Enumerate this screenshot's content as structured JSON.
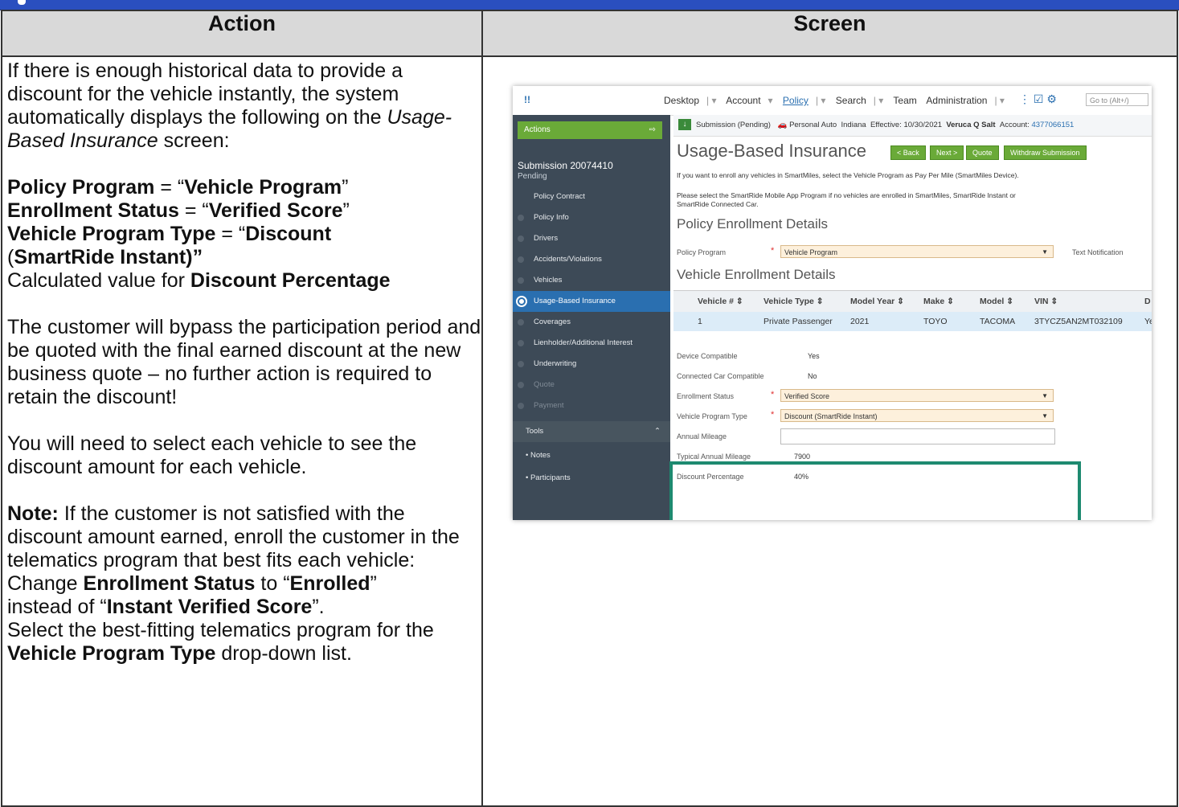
{
  "header": {
    "action": "Action",
    "screen": "Screen"
  },
  "action": {
    "intro": "If there is enough historical data to provide a discount for the vehicle instantly, the system automatically displays the following on the ",
    "intro_screen": "Usage-Based Insurance",
    "intro_end": " screen:",
    "l1_label": "Policy Program",
    "l1_eq": " = “",
    "l1_value": "Vehicle Program",
    "l1_end": "”",
    "l2_label": "Enrollment Status",
    "l2_eq": " = “",
    "l2_value": "Verified Score",
    "l2_end": "”",
    "l3_label": "Vehicle Program Type",
    "l3_eq": " = “",
    "l3_value": "Discount",
    "l3_paren": " (",
    "l3_value2": "SmartRide Instant)”",
    "l4_prefix": "Calculated value for ",
    "l4_label": "Discount Percentage",
    "bypass": "The customer will bypass the participation period and be quoted with the final earned discount at the new business quote – no further action is required to retain the discount!",
    "select_each": "You will need to select each vehicle to see the discount amount for each vehicle.",
    "note_label": "Note:",
    "note_text": " If the customer is not satisfied with the discount amount earned, enroll the customer in the telematics program that best fits each vehicle:",
    "change_a": "Change ",
    "change_b": "Enrollment Status",
    "change_c": " to “",
    "change_d": "Enrolled",
    "change_e": "”",
    "instead_a": "instead of “",
    "instead_b": "Instant Verified Score",
    "instead_c": "”.",
    "select_a": "Select the best-fitting telematics program for the ",
    "select_b": "Vehicle Program Type",
    "select_c": " drop-down list."
  },
  "screenshot": {
    "nav": {
      "desktop": "Desktop",
      "account": "Account",
      "policy": "Policy",
      "search": "Search",
      "team": "Team",
      "administration": "Administration",
      "goto_placeholder": "Go to (Alt+/)"
    },
    "sidebar": {
      "actions": "Actions",
      "submission": "Submission 20074410",
      "status": "Pending",
      "items": [
        "Policy Contract",
        "Policy Info",
        "Drivers",
        "Accidents/Violations",
        "Vehicles",
        "Usage-Based Insurance",
        "Coverages",
        "Lienholder/Additional Interest",
        "Underwriting",
        "Quote",
        "Payment"
      ],
      "tools": "Tools",
      "notes": "• Notes",
      "participants": "• Participants"
    },
    "infobar": {
      "submission": "Submission (Pending)",
      "line": "Personal Auto",
      "state": "Indiana",
      "effective": "Effective: 10/30/2021",
      "insured": "Veruca Q Salt",
      "account_label": "Account:",
      "account_no": "4377066151"
    },
    "title": "Usage-Based Insurance",
    "buttons": {
      "back": "< Back",
      "next": "Next >",
      "quote": "Quote",
      "withdraw": "Withdraw Submission"
    },
    "msg1": "If you want to enroll any vehicles in SmartMiles, select the Vehicle Program as Pay Per Mile (SmartMiles Device).",
    "msg2": "Please select the SmartRide Mobile App Program if no vehicles are enrolled in SmartMiles, SmartRide Instant or SmartRide Connected Car.",
    "policy_section": "Policy Enrollment Details",
    "policy_program_label": "Policy Program",
    "policy_program_value": "Vehicle Program",
    "text_notification": "Text Notification",
    "vehicle_section": "Vehicle Enrollment Details",
    "table": {
      "headers": [
        "Vehicle # ⇕",
        "Vehicle Type ⇕",
        "Model Year ⇕",
        "Make ⇕",
        "Model ⇕",
        "VIN ⇕",
        "D"
      ],
      "row": [
        "1",
        "Private Passenger",
        "2021",
        "TOYO",
        "TACOMA",
        "3TYCZ5AN2MT032109",
        "Ye"
      ]
    },
    "fields": {
      "device_label": "Device Compatible",
      "device_value": "Yes",
      "connected_label": "Connected Car Compatible",
      "connected_value": "No",
      "enroll_label": "Enrollment Status",
      "enroll_value": "Verified Score",
      "vpt_label": "Vehicle Program Type",
      "vpt_value": "Discount (SmartRide Instant)",
      "annual_label": "Annual Mileage",
      "typical_label": "Typical Annual Mileage",
      "typical_value": "7900",
      "discount_label": "Discount Percentage",
      "discount_value": "40%"
    }
  }
}
